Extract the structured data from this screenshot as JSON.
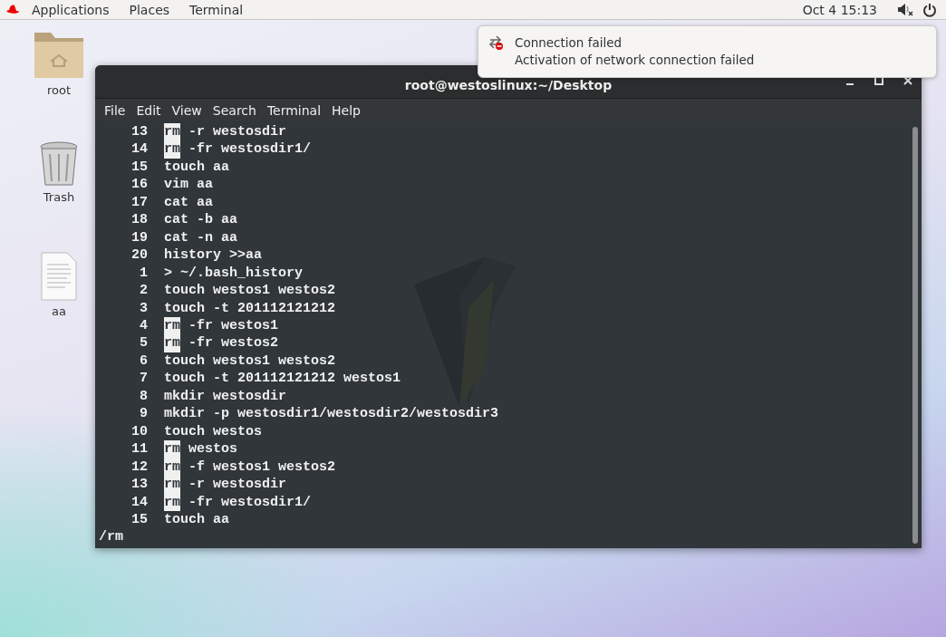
{
  "top_bar": {
    "menus": [
      "Applications",
      "Places",
      "Terminal"
    ],
    "clock": "Oct 4  15:13"
  },
  "desktop_icons": [
    {
      "kind": "folder",
      "label": "root"
    },
    {
      "kind": "trash",
      "label": "Trash"
    },
    {
      "kind": "document",
      "label": "aa"
    }
  ],
  "notification": {
    "title": "Connection failed",
    "body": "Activation of network connection failed"
  },
  "terminal": {
    "title": "root@westoslinux:~/Desktop",
    "menus": [
      "File",
      "Edit",
      "View",
      "Search",
      "Terminal",
      "Help"
    ],
    "lines": [
      {
        "number": "13",
        "highlight": "rm",
        "text": "-r westosdir"
      },
      {
        "number": "14",
        "highlight": "rm",
        "text": "-fr westosdir1/"
      },
      {
        "number": "15",
        "text": "touch aa"
      },
      {
        "number": "16",
        "text": "vim aa"
      },
      {
        "number": "17",
        "text": "cat aa"
      },
      {
        "number": "18",
        "text": "cat -b aa"
      },
      {
        "number": "19",
        "text": "cat -n aa"
      },
      {
        "number": "20",
        "text": "history >>aa"
      },
      {
        "number": "1",
        "text": "> ~/.bash_history"
      },
      {
        "number": "2",
        "text": "touch westos1 westos2"
      },
      {
        "number": "3",
        "text": "touch -t 201112121212"
      },
      {
        "number": "4",
        "highlight": "rm",
        "text": "-fr westos1"
      },
      {
        "number": "5",
        "highlight": "rm",
        "text": "-fr westos2"
      },
      {
        "number": "6",
        "text": "touch westos1 westos2"
      },
      {
        "number": "7",
        "text": "touch -t 201112121212 westos1"
      },
      {
        "number": "8",
        "text": "mkdir westosdir"
      },
      {
        "number": "9",
        "text": "mkdir -p westosdir1/westosdir2/westosdir3"
      },
      {
        "number": "10",
        "text": "touch westos"
      },
      {
        "number": "11",
        "highlight": "rm",
        "text": "westos"
      },
      {
        "number": "12",
        "highlight": "rm",
        "text": "-f westos1 westos2"
      },
      {
        "number": "13",
        "highlight": "rm",
        "text": "-r westosdir"
      },
      {
        "number": "14",
        "highlight": "rm",
        "text": "-fr westosdir1/"
      },
      {
        "number": "15",
        "text": "touch aa"
      }
    ],
    "search_prompt": "/rm"
  }
}
